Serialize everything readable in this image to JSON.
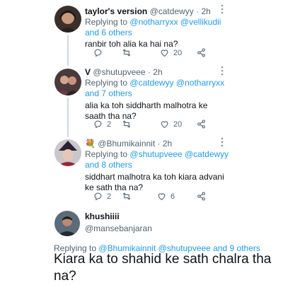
{
  "tweets": [
    {
      "name": "taylor's version",
      "handle": "@catdewyy",
      "time": "2h",
      "replying_prefix": "Replying to",
      "replying_mentions": "@notharryxx @vellikudii and 6 others",
      "text": "ranbir toh alia ka hai na?",
      "reply_count": "",
      "retweet_count": "",
      "like_count": "20"
    },
    {
      "name": "V",
      "handle": "@shutupveee",
      "time": "2h",
      "replying_prefix": "Replying to",
      "replying_mentions": "@catdewyy @notharryxx and 7 others",
      "text": "alia ka toh siddharth malhotra ke saath tha na?",
      "reply_count": "2",
      "retweet_count": "",
      "like_count": "20"
    },
    {
      "name_emoji": "💐",
      "handle": "@Bhumikainnit",
      "time": "2h",
      "replying_prefix": "Replying to",
      "replying_mentions": "@shutupveee @catdewyy and 8 others",
      "text": "siddhart malhotra ka toh kiara advani ke sath tha na?",
      "reply_count": "2",
      "retweet_count": "",
      "like_count": "6"
    }
  ],
  "main_tweet": {
    "name": "khushiiii",
    "handle": "@mansebanjaran",
    "replying_prefix": "Replying to",
    "replying_mentions": "@Bhumikainnit @shutupveee and 9 others",
    "text": "Kiara ka to shahid ke sath chalra tha na?"
  },
  "colors": {
    "accent": "#1d9bf0",
    "muted": "#536471",
    "text": "#0f1419"
  }
}
